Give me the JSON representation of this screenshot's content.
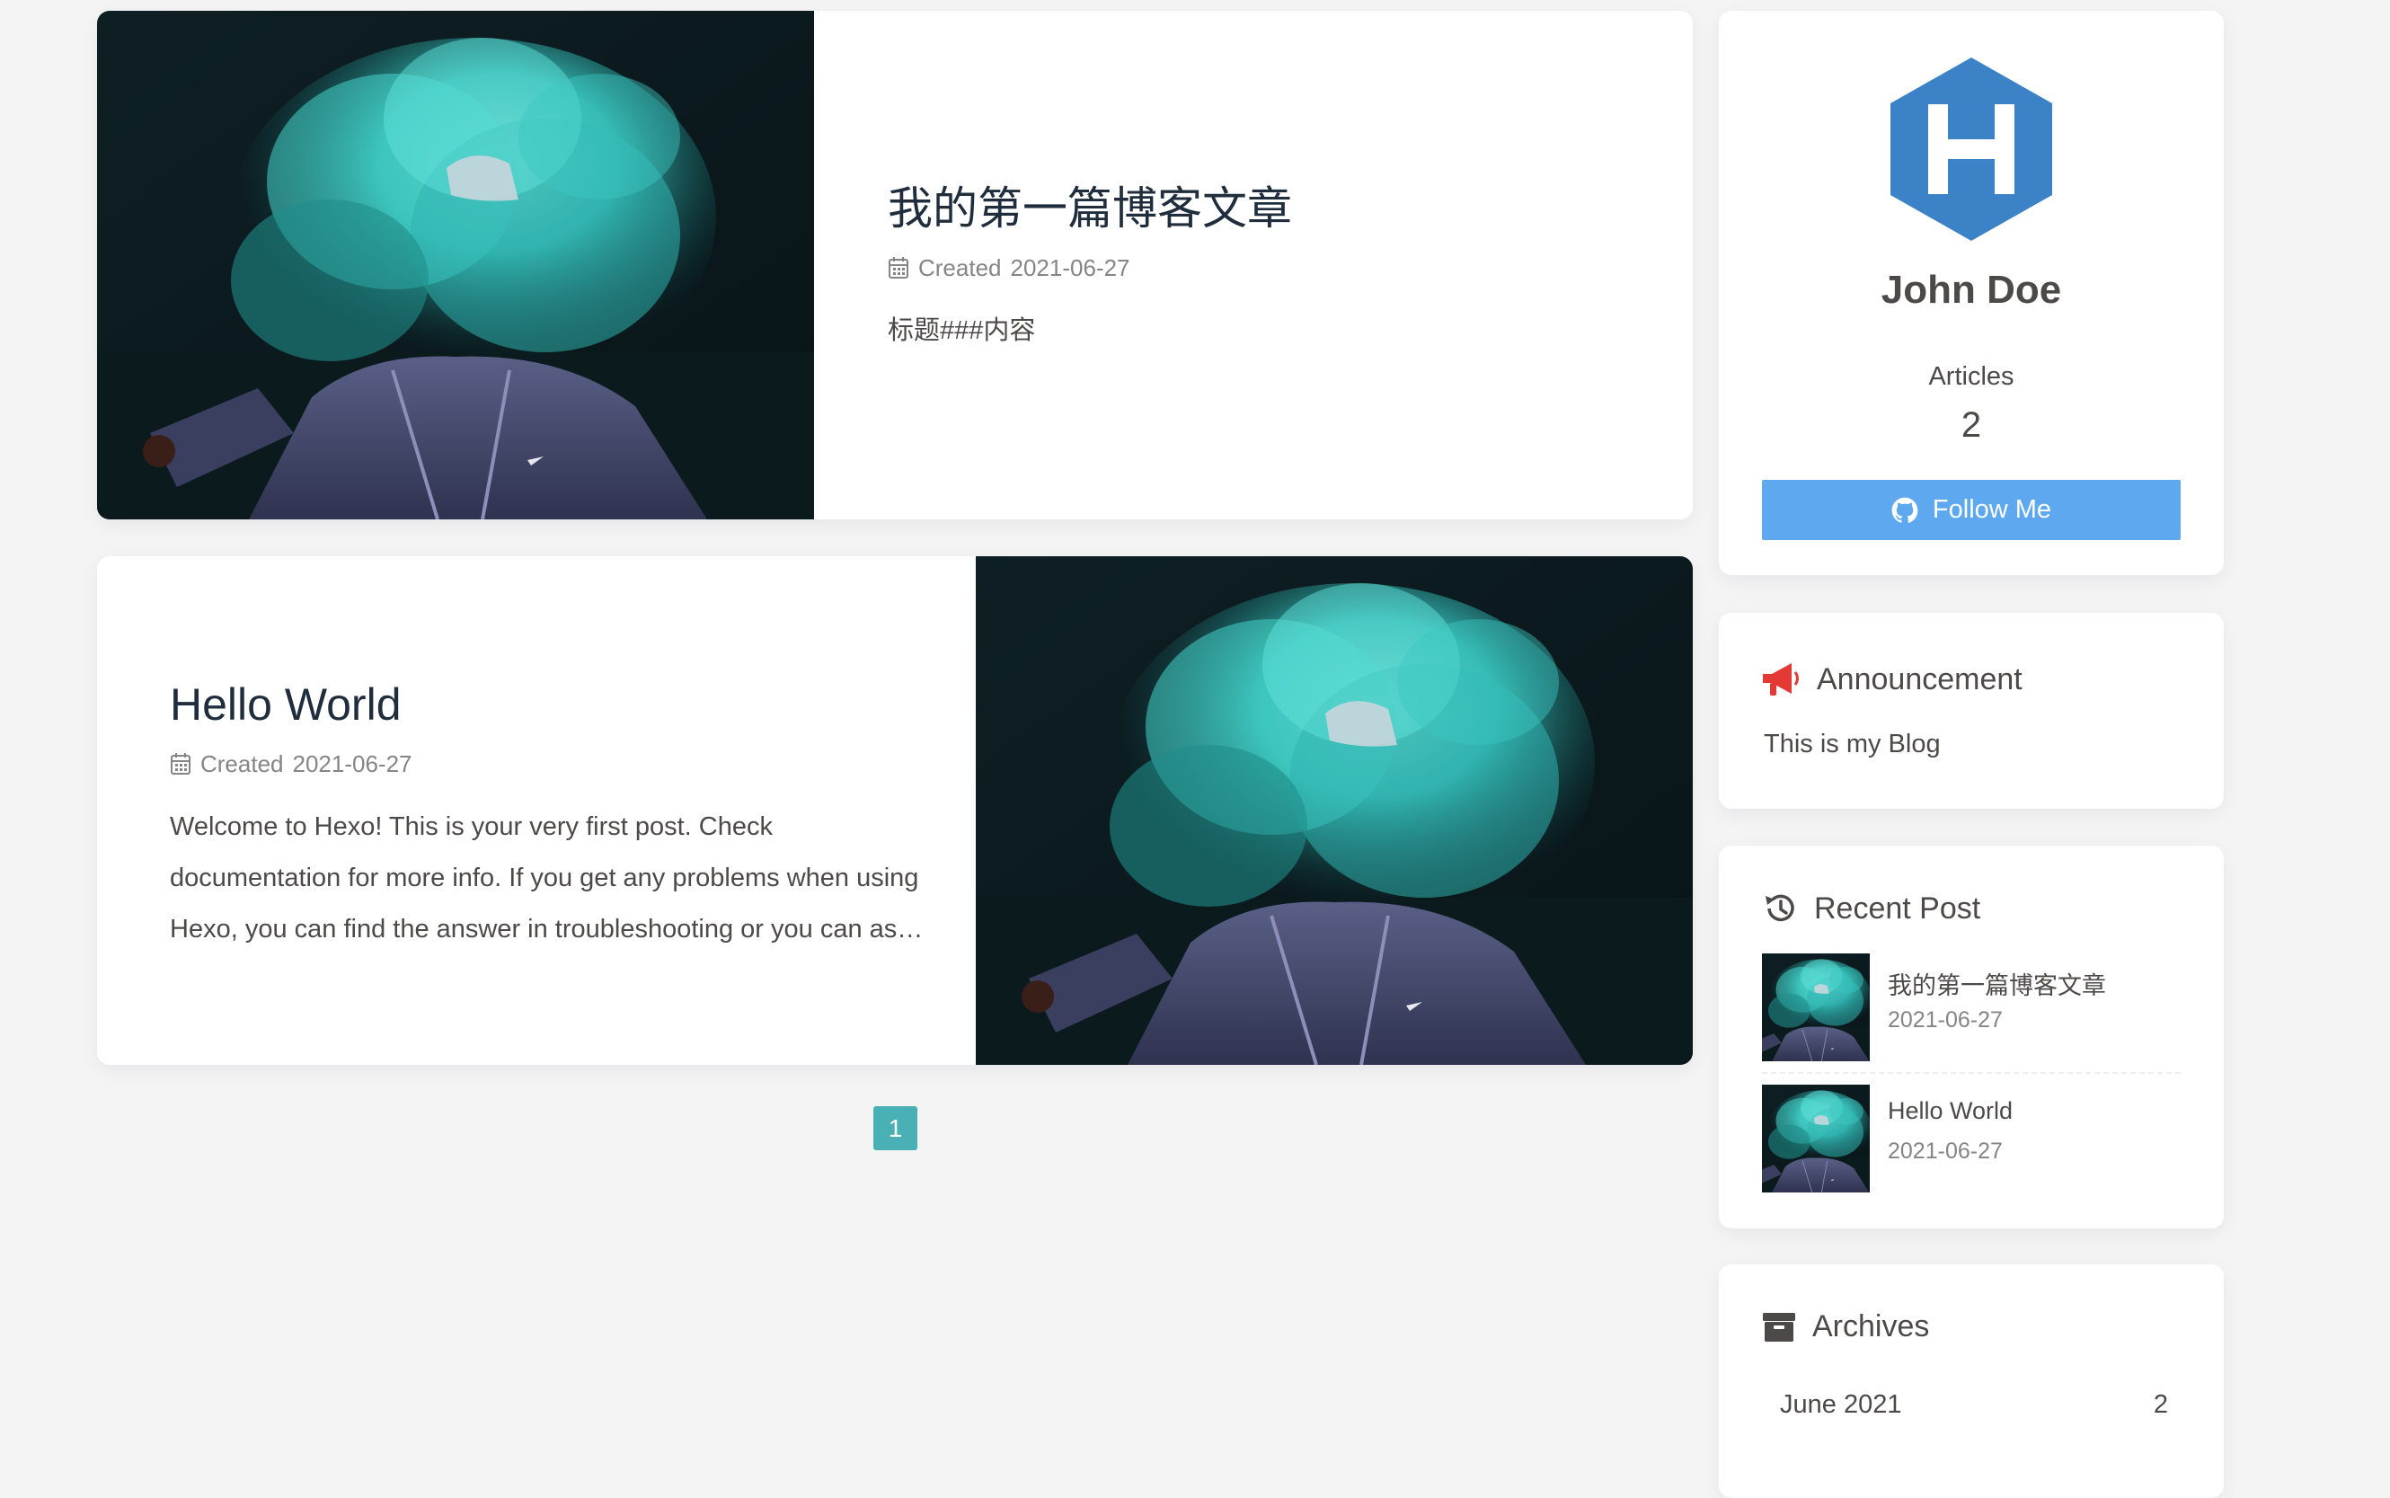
{
  "posts": [
    {
      "title": "我的第一篇博客文章",
      "meta_label": "Created",
      "date": "2021-06-27",
      "excerpt": "标题###内容",
      "cover_icon": "smoke-person-cover-image"
    },
    {
      "title": "Hello World",
      "meta_label": "Created",
      "date": "2021-06-27",
      "excerpt": "Welcome to Hexo! This is your very first post. Check documentation for more info. If you get any problems when using Hexo, you can find the answer in troubleshooting or you can ask me on GitHub.",
      "cover_icon": "smoke-person-cover-image"
    }
  ],
  "pagination": {
    "current": "1"
  },
  "author": {
    "name": "John Doe",
    "avatar_icon": "hexo-hexagon-logo",
    "articles_label": "Articles",
    "articles_count": "2",
    "follow_label": "Follow Me",
    "follow_icon": "github-icon"
  },
  "announcement": {
    "title": "Announcement",
    "icon": "megaphone-icon",
    "text": "This is my Blog"
  },
  "recent": {
    "title": "Recent Post",
    "icon": "history-icon",
    "items": [
      {
        "title": "我的第一篇博客文章",
        "date": "2021-06-27"
      },
      {
        "title": "Hello World",
        "date": "2021-06-27"
      }
    ]
  },
  "archives": {
    "title": "Archives",
    "icon": "archive-box-icon",
    "items": [
      {
        "label": "June 2021",
        "count": "2"
      }
    ]
  },
  "colors": {
    "background": "#f4f4f5",
    "card": "#ffffff",
    "accent_teal": "#49b1b5",
    "follow_button": "#5ea8ef",
    "hexo_blue": "#3b82c6",
    "megaphone_red": "#e53935",
    "text": "#4c4948",
    "title": "#1f2d3d",
    "meta": "#858585"
  }
}
